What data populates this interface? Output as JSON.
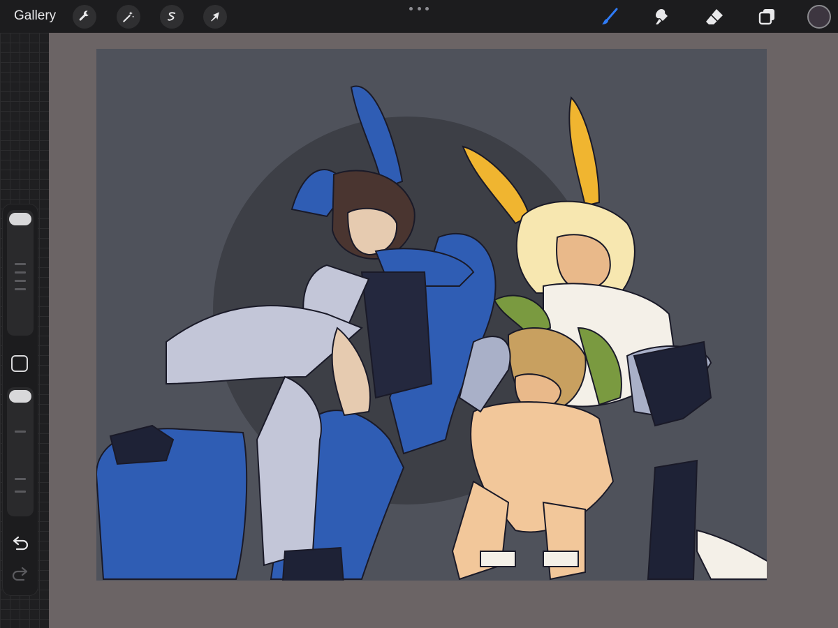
{
  "topbar": {
    "gallery_label": "Gallery",
    "left_tools": [
      {
        "icon": "wrench-icon",
        "name": "actions"
      },
      {
        "icon": "magic-wand-icon",
        "name": "adjustments"
      },
      {
        "icon": "selection-icon",
        "name": "selection"
      },
      {
        "icon": "arrow-cursor-icon",
        "name": "transform"
      }
    ],
    "right_tools": [
      {
        "icon": "brush-icon",
        "name": "paint",
        "active": true,
        "color": "#2f7bf6"
      },
      {
        "icon": "smudge-icon",
        "name": "smudge",
        "active": false
      },
      {
        "icon": "eraser-icon",
        "name": "erase",
        "active": false
      },
      {
        "icon": "layers-icon",
        "name": "layers",
        "active": false
      }
    ],
    "current_color": "#3d3640"
  },
  "sidebar": {
    "brush_size_icon": "slider-icon",
    "opacity_icon": "slider-icon",
    "modify_icon": "square-icon",
    "undo_icon": "undo-arrow-icon",
    "redo_icon": "redo-arrow-icon"
  },
  "canvas": {
    "background_color": "#4f525b",
    "content": "illustration"
  }
}
